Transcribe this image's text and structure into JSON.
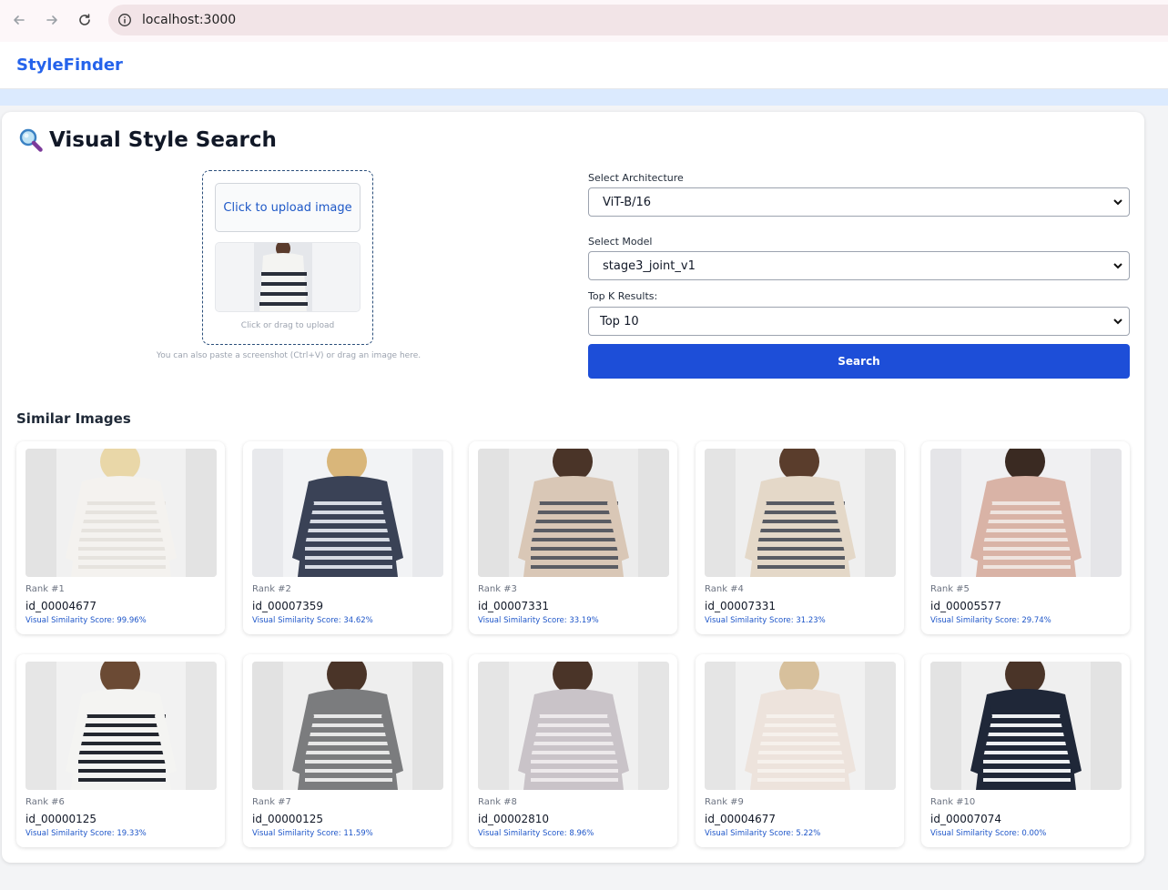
{
  "browser": {
    "url": "localhost:3000",
    "icons": [
      "back-arrow-icon",
      "forward-arrow-icon",
      "reload-icon",
      "site-info-icon"
    ]
  },
  "header": {
    "brand": "StyleFinder"
  },
  "search_panel": {
    "title": "Visual Style Search",
    "title_icon": "magnifier-icon",
    "upload_button_label": "Click to upload image",
    "upload_hint": "Click or drag to upload",
    "paste_hint": "You can also paste a screenshot (Ctrl+V) or drag an image here.",
    "architecture_label": "Select Architecture",
    "architecture_value": "ViT-B/16",
    "model_label": "Select Model",
    "model_value": "stage3_joint_v1",
    "topk_label": "Top K Results:",
    "topk_value": "Top 10",
    "search_button_label": "Search"
  },
  "results": {
    "title": "Similar Images",
    "items": [
      {
        "rank": "Rank #1",
        "id": "id_00004677",
        "score": "Visual Similarity Score: 99.96%"
      },
      {
        "rank": "Rank #2",
        "id": "id_00007359",
        "score": "Visual Similarity Score: 34.62%"
      },
      {
        "rank": "Rank #3",
        "id": "id_00007331",
        "score": "Visual Similarity Score: 33.19%"
      },
      {
        "rank": "Rank #4",
        "id": "id_00007331",
        "score": "Visual Similarity Score: 31.23%"
      },
      {
        "rank": "Rank #5",
        "id": "id_00005577",
        "score": "Visual Similarity Score: 29.74%"
      },
      {
        "rank": "Rank #6",
        "id": "id_00000125",
        "score": "Visual Similarity Score: 19.33%"
      },
      {
        "rank": "Rank #7",
        "id": "id_00000125",
        "score": "Visual Similarity Score: 11.59%"
      },
      {
        "rank": "Rank #8",
        "id": "id_00002810",
        "score": "Visual Similarity Score: 8.96%"
      },
      {
        "rank": "Rank #9",
        "id": "id_00004677",
        "score": "Visual Similarity Score: 5.22%"
      },
      {
        "rank": "Rank #10",
        "id": "id_00007074",
        "score": "Visual Similarity Score: 0.00%"
      }
    ]
  },
  "colors": {
    "brand": "#2563eb",
    "search_button": "#1d4ed8",
    "score_text": "#1e56c9",
    "header_strip": "#dbeafe"
  }
}
